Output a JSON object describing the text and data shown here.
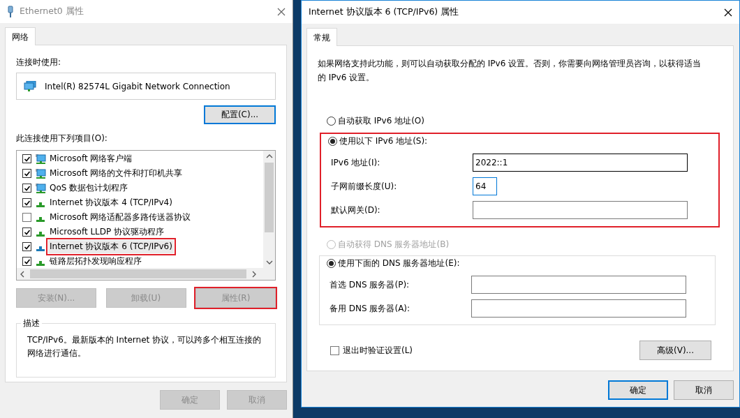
{
  "left_window": {
    "title": "Ethernet0 属性",
    "tabs": [
      {
        "label": "网络",
        "selected": true
      }
    ],
    "connect_using_label": "连接时使用:",
    "adapter": "Intel(R) 82574L Gigabit Network Connection",
    "configure_button": "配置(C)...",
    "items_label": "此连接使用下列项目(O):",
    "items": [
      {
        "label": "Microsoft 网络客户端",
        "checked": true,
        "kind": "service",
        "selected": false,
        "highlighted": false
      },
      {
        "label": "Microsoft 网络的文件和打印机共享",
        "checked": true,
        "kind": "service",
        "selected": false,
        "highlighted": false
      },
      {
        "label": "QoS 数据包计划程序",
        "checked": true,
        "kind": "service",
        "selected": false,
        "highlighted": false
      },
      {
        "label": "Internet 协议版本 4 (TCP/IPv4)",
        "checked": true,
        "kind": "protocol",
        "selected": false,
        "highlighted": false
      },
      {
        "label": "Microsoft 网络适配器多路传送器协议",
        "checked": false,
        "kind": "protocol",
        "selected": false,
        "highlighted": false
      },
      {
        "label": "Microsoft LLDP 协议驱动程序",
        "checked": true,
        "kind": "protocol",
        "selected": false,
        "highlighted": false
      },
      {
        "label": "Internet 协议版本 6 (TCP/IPv6)",
        "checked": true,
        "kind": "protocol",
        "selected": true,
        "highlighted": true
      },
      {
        "label": "链路层拓扑发现响应程序",
        "checked": true,
        "kind": "protocol",
        "selected": false,
        "highlighted": false
      }
    ],
    "item_buttons": [
      {
        "label": "安装(N)...",
        "disabled": true,
        "highlighted": false
      },
      {
        "label": "卸载(U)",
        "disabled": true,
        "highlighted": false
      },
      {
        "label": "属性(R)",
        "disabled": true,
        "highlighted": true
      }
    ],
    "description": {
      "title": "描述",
      "text": "TCP/IPv6。最新版本的 Internet 协议，可以跨多个相互连接的网络进行通信。"
    },
    "buttons": [
      {
        "label": "确定",
        "disabled": true
      },
      {
        "label": "取消",
        "disabled": true
      }
    ]
  },
  "right_window": {
    "title": "Internet 协议版本 6 (TCP/IPv6) 属性",
    "tabs": [
      {
        "label": "常规",
        "selected": true
      }
    ],
    "intro": "如果网络支持此功能，则可以自动获取分配的 IPv6 设置。否则，你需要向网络管理员咨询，以获得适当的 IPv6 设置。",
    "address_mode": [
      {
        "label": "自动获取 IPv6 地址(O)",
        "selected": false,
        "disabled": false
      },
      {
        "label": "使用以下 IPv6 地址(S):",
        "selected": true,
        "disabled": false
      }
    ],
    "address_highlighted": true,
    "address_fields": [
      {
        "label": "IPv6 地址(I):",
        "value": "2022::1",
        "focused": false,
        "hovered": true
      },
      {
        "label": "子网前缀长度(U):",
        "value": "64",
        "focused": true,
        "hovered": false
      },
      {
        "label": "默认网关(D):",
        "focused": false,
        "hovered": false
      }
    ],
    "dns_mode": [
      {
        "label": "自动获得 DNS 服务器地址(B)",
        "selected": false,
        "disabled": true
      },
      {
        "label": "使用下面的 DNS 服务器地址(E):",
        "selected": true,
        "disabled": false
      }
    ],
    "dns_fields": [
      {
        "label": "首选 DNS 服务器(P):"
      },
      {
        "label": "备用 DNS 服务器(A):"
      }
    ],
    "validate_checkbox": {
      "label": "退出时验证设置(L)",
      "checked": false
    },
    "advanced_button": "高级(V)...",
    "buttons": [
      {
        "label": "确定",
        "default": true
      },
      {
        "label": "取消",
        "default": false
      }
    ]
  }
}
